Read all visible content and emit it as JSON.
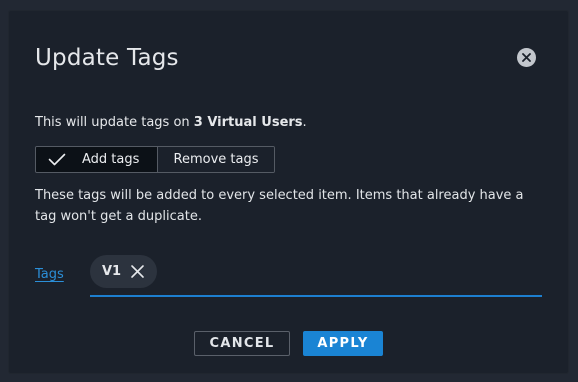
{
  "dialog": {
    "title": "Update Tags",
    "close_icon": "close-icon",
    "intro_prefix": "This will update tags on ",
    "intro_bold": "3 Virtual Users",
    "intro_suffix": "."
  },
  "mode_toggle": {
    "options": [
      {
        "label": "Add tags",
        "selected": true,
        "icon": "check-icon"
      },
      {
        "label": "Remove tags",
        "selected": false
      }
    ]
  },
  "description": "These tags will be added to every selected item. Items that already have a tag won't get a duplicate.",
  "tags_field": {
    "label": "Tags",
    "chips": [
      {
        "label": "V1",
        "remove_icon": "close-icon"
      }
    ]
  },
  "footer": {
    "cancel_label": "CANCEL",
    "apply_label": "APPLY"
  },
  "colors": {
    "background": "#1b212b",
    "accent": "#1a84d4",
    "link": "#2b8fd8",
    "chip": "#2c333e"
  }
}
